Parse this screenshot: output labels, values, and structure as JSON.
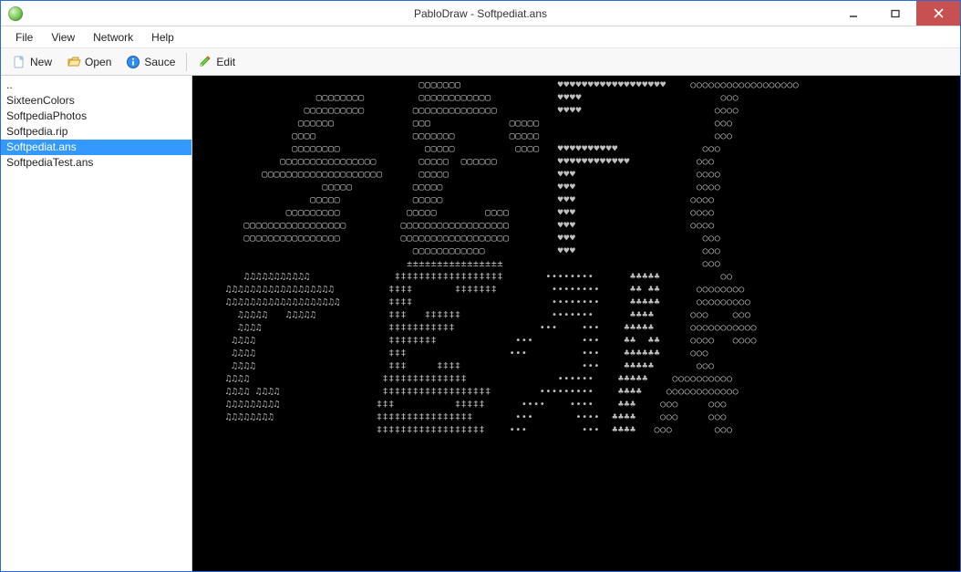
{
  "window": {
    "title": "PabloDraw - Softpediat.ans"
  },
  "menubar": {
    "items": [
      "File",
      "View",
      "Network",
      "Help"
    ]
  },
  "toolbar": {
    "new": "New",
    "open": "Open",
    "sauce": "Sauce",
    "edit": "Edit"
  },
  "sidebar": {
    "items": [
      {
        "label": "..",
        "selected": false
      },
      {
        "label": "SixteenColors",
        "selected": false
      },
      {
        "label": "SoftpediaPhotos",
        "selected": false
      },
      {
        "label": "Softpedia.rip",
        "selected": false
      },
      {
        "label": "Softpediat.ans",
        "selected": true
      },
      {
        "label": "SoftpediaTest.ans",
        "selected": false
      }
    ]
  },
  "icons": {
    "app": "app-icon",
    "minimize": "minimize-icon",
    "maximize": "maximize-icon",
    "close": "close-icon",
    "new": "new-file-icon",
    "open": "open-folder-icon",
    "sauce": "info-icon",
    "edit": "pencil-icon"
  },
  "canvas": {
    "ascii": "                                    ▢▢▢▢▢▢▢                ♥♥♥♥♥♥♥♥♥♥♥♥♥♥♥♥♥♥    ○○○○○○○○○○○○○○○○○○\n                   ▢▢▢▢▢▢▢▢         ▢▢▢▢▢▢▢▢▢▢▢▢           ♥♥♥♥                       ○○○\n                 ▢▢▢▢▢▢▢▢▢▢        ▢▢▢▢▢▢▢▢▢▢▢▢▢▢          ♥♥♥♥                      ○○○○\n                ▢▢▢▢▢▢             ▢▢▢             ▢▢▢▢▢                             ○○○\n               ▢▢▢▢                ▢▢▢▢▢▢▢         ▢▢▢▢▢                             ○○○\n               ▢▢▢▢▢▢▢▢              ▢▢▢▢▢          ▢▢▢▢   ♥♥♥♥♥♥♥♥♥♥              ○○○\n             ▢▢▢▢▢▢▢▢▢▢▢▢▢▢▢▢       ▢▢▢▢▢  ▢▢▢▢▢▢          ♥♥♥♥♥♥♥♥♥♥♥♥           ○○○\n          ▢▢▢▢▢▢▢▢▢▢▢▢▢▢▢▢▢▢▢▢      ▢▢▢▢▢                  ♥♥♥                    ○○○○\n                    ▢▢▢▢▢          ▢▢▢▢▢                   ♥♥♥                    ○○○○\n                  ▢▢▢▢▢            ▢▢▢▢▢                   ♥♥♥                   ○○○○\n              ▢▢▢▢▢▢▢▢▢           ▢▢▢▢▢        ▢▢▢▢        ♥♥♥                   ○○○○\n       ▢▢▢▢▢▢▢▢▢▢▢▢▢▢▢▢▢         ▢▢▢▢▢▢▢▢▢▢▢▢▢▢▢▢▢▢        ♥♥♥                   ○○○○\n       ▢▢▢▢▢▢▢▢▢▢▢▢▢▢▢▢          ▢▢▢▢▢▢▢▢▢▢▢▢▢▢▢▢▢▢        ♥♥♥                     ○○○\n                                   ▢▢▢▢▢▢▢▢▢▢▢▢            ♥♥♥                     ○○○\n                                  ±±±±±±±±±±±±±±±±                                 ○○○\n       ♫♫♫♫♫♫♫♫♫♫♫              ‡‡‡‡‡‡‡‡‡‡‡‡‡‡‡‡‡‡       ••••••••      ♣♣♣♣♣          ○○\n    ♫♫♫♫♫♫♫♫♫♫♫♫♫♫♫♫♫♫         ‡‡‡‡       ‡‡‡‡‡‡‡         ••••••••     ♣♣ ♣♣      ○○○○○○○○\n    ♫♫♫♫♫♫♫♫♫♫♫♫♫♫♫♫♫♫♫        ‡‡‡‡                       ••••••••     ♣♣♣♣♣      ○○○○○○○○○\n      ♫♫♫♫♫   ♫♫♫♫♫            ‡‡‡   ‡‡‡‡‡‡               •••••••      ♣♣♣♣      ○○○    ○○○\n      ♫♫♫♫                     ‡‡‡‡‡‡‡‡‡‡‡              •••    •••    ♣♣♣♣♣      ○○○○○○○○○○○\n     ♫♫♫♫                      ‡‡‡‡‡‡‡‡             •••        •••    ♣♣  ♣♣     ○○○○   ○○○○\n     ♫♫♫♫                      ‡‡‡                 •••         •••    ♣♣♣♣♣♣     ○○○\n     ♫♫♫♫                      ‡‡‡     ‡‡‡‡                    •••    ♣♣♣♣♣       ○○○\n    ♫♫♫♫                      ‡‡‡‡‡‡‡‡‡‡‡‡‡‡               ••••••    ♣♣♣♣♣    ○○○○○○○○○○\n    ♫♫♫♫ ♫♫♫♫                 ‡‡‡‡‡‡‡‡‡‡‡‡‡‡‡‡‡‡        •••••••••    ♣♣♣♣    ○○○○○○○○○○○○\n    ♫♫♫♫♫♫♫♫♫                ‡‡‡          ‡‡‡‡‡      ••••    ••••    ♣♣♣    ○○○     ○○○\n    ♫♫♫♫♫♫♫♫                 ‡‡‡‡‡‡‡‡‡‡‡‡‡‡‡‡       •••       ••••  ♣♣♣♣    ○○○     ○○○\n                             ‡‡‡‡‡‡‡‡‡‡‡‡‡‡‡‡‡‡    •••         •••  ♣♣♣♣   ○○○       ○○○"
  }
}
